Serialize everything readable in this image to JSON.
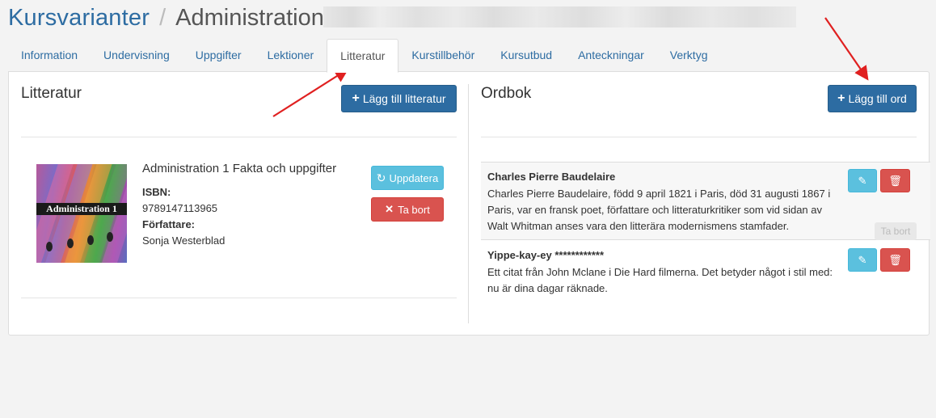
{
  "header": {
    "breadcrumb_link": "Kursvarianter",
    "separator": "/",
    "current": "Administration"
  },
  "tabs": [
    {
      "label": "Information",
      "active": false
    },
    {
      "label": "Undervisning",
      "active": false
    },
    {
      "label": "Uppgifter",
      "active": false
    },
    {
      "label": "Lektioner",
      "active": false
    },
    {
      "label": "Litteratur",
      "active": true
    },
    {
      "label": "Kurstillbehör",
      "active": false
    },
    {
      "label": "Kursutbud",
      "active": false
    },
    {
      "label": "Anteckningar",
      "active": false
    },
    {
      "label": "Verktyg",
      "active": false
    }
  ],
  "literature": {
    "title": "Litteratur",
    "add_button": "Lägg till litteratur",
    "book": {
      "cover_text": "Administration 1",
      "title": "Administration 1 Fakta och uppgifter",
      "isbn_label": "ISBN:",
      "isbn": "9789147113965",
      "author_label": "Författare:",
      "author": "Sonja Westerblad",
      "update_button": "Uppdatera",
      "delete_button": "Ta bort"
    }
  },
  "dictionary": {
    "title": "Ordbok",
    "add_button": "Lägg till ord",
    "entries": [
      {
        "term": "Charles Pierre Baudelaire",
        "definition": "Charles Pierre Baudelaire, född 9 april 1821 i Paris, död 31 augusti 1867 i Paris, var en fransk poet, författare och litteraturkritiker som vid sidan av Walt Whitman anses vara den litterära modernismens stamfader."
      },
      {
        "term": "Yippe-kay-ey ************",
        "definition": "Ett citat från John Mclane i Die Hard filmerna. Det betyder något i stil med: nu är dina dagar räknade."
      }
    ],
    "tooltip": "Ta bort"
  },
  "colors": {
    "primary": "#2d6ca2",
    "info": "#5bc0de",
    "danger": "#d9534f",
    "arrow": "#e02020"
  }
}
